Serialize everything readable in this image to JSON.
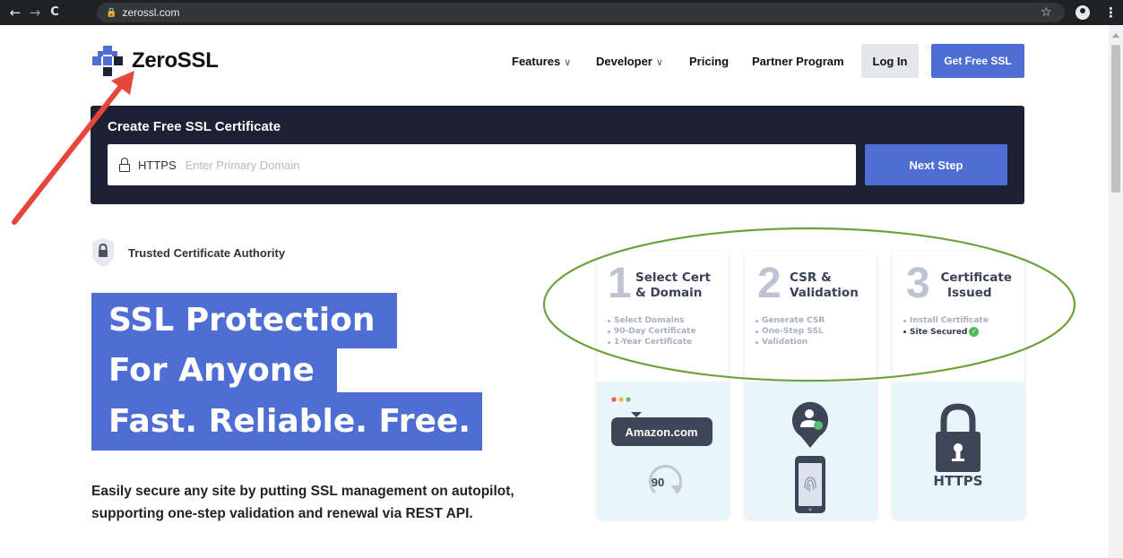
{
  "browser": {
    "url": "zerossl.com",
    "back_icon": "←",
    "forward_icon": "→",
    "reload_icon": "C",
    "lock_icon": "🔒",
    "star_icon": "☆",
    "menu_icon": "⋮"
  },
  "header": {
    "brand": "ZeroSSL",
    "nav": {
      "features": "Features",
      "developer": "Developer",
      "pricing": "Pricing",
      "partner": "Partner Program",
      "chevron": "∨"
    },
    "login_label": "Log In",
    "cta_label": "Get Free SSL"
  },
  "create": {
    "title": "Create Free SSL Certificate",
    "prefix": "HTTPS",
    "placeholder": "Enter Primary Domain",
    "value": "",
    "button": "Next Step"
  },
  "trusted": {
    "label": "Trusted Certificate Authority"
  },
  "hero": {
    "line1": "SSL Protection",
    "line2": "For Anyone",
    "line3": "Fast. Reliable. Free.",
    "description_1": "Easily secure any site by putting SSL management on autopilot,",
    "description_2": "supporting one-step validation and renewal via REST API."
  },
  "steps": [
    {
      "number": "1",
      "title_1": "Select Cert",
      "title_2": "& Domain",
      "items": [
        "Select Domains",
        "90-Day Certificate",
        "1-Year Certificate"
      ],
      "illustration": {
        "domain_label": "Amazon.com",
        "days": "90"
      }
    },
    {
      "number": "2",
      "title_1": "CSR &",
      "title_2": "Validation",
      "items": [
        "Generate CSR",
        "One-Step SSL",
        "Validation"
      ]
    },
    {
      "number": "3",
      "title_1": "Certificate",
      "title_2": "Issued",
      "items": [
        "Install Certificate",
        "Site Secured"
      ],
      "illustration": {
        "label": "HTTPS"
      }
    }
  ],
  "colors": {
    "brand_blue": "#4f6ed4",
    "dark_navy": "#1c2234",
    "annotation_red": "#e8453c",
    "annotation_green": "#6aa33a",
    "card_light": "#e8f5fb"
  }
}
